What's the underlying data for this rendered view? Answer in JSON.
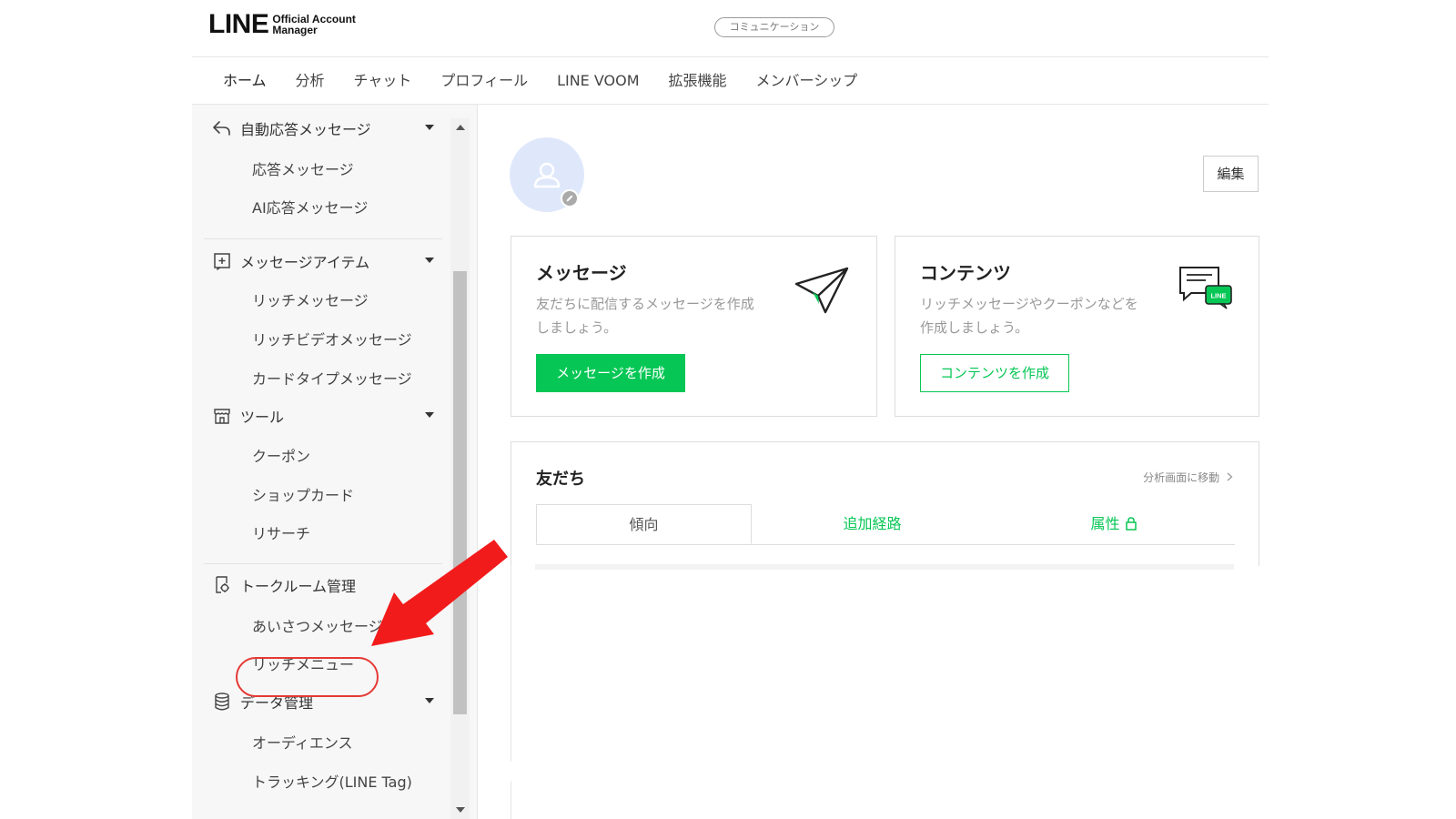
{
  "header": {
    "logo_main": "LINE",
    "logo_sub_line1": "Official Account",
    "logo_sub_line2": "Manager",
    "mode_badge": "コミュニケーション"
  },
  "nav": {
    "tabs": [
      "ホーム",
      "分析",
      "チャット",
      "プロフィール",
      "LINE VOOM",
      "拡張機能",
      "メンバーシップ"
    ],
    "active_tab": "ホーム"
  },
  "sidebar": {
    "groups": [
      {
        "label": "自動応答メッセージ",
        "icon": "reply-icon",
        "items": [
          "応答メッセージ",
          "AI応答メッセージ"
        ]
      },
      {
        "label": "メッセージアイテム",
        "icon": "plus-square-icon",
        "items": [
          "リッチメッセージ",
          "リッチビデオメッセージ",
          "カードタイプメッセージ"
        ]
      },
      {
        "label": "ツール",
        "icon": "shop-icon",
        "items": [
          "クーポン",
          "ショップカード",
          "リサーチ"
        ]
      },
      {
        "label": "トークルーム管理",
        "icon": "chat-settings-icon",
        "items": [
          "あいさつメッセージ",
          "リッチメニュー"
        ]
      },
      {
        "label": "データ管理",
        "icon": "database-icon",
        "items": [
          "オーディエンス",
          "トラッキング(LINE Tag)"
        ]
      }
    ],
    "highlighted_item": "リッチメニュー"
  },
  "profile": {
    "edit_label": "編集"
  },
  "cards": {
    "message": {
      "title": "メッセージ",
      "desc_line1": "友だちに配信するメッセージを作成",
      "desc_line2": "しましょう。",
      "button": "メッセージを作成",
      "icon": "paper-plane-icon"
    },
    "contents": {
      "title": "コンテンツ",
      "desc_line1": "リッチメッセージやクーポンなどを",
      "desc_line2": "作成しましょう。",
      "button": "コンテンツを作成",
      "icon": "line-chat-icon",
      "icon_badge": "LINE"
    }
  },
  "friends": {
    "title": "友だち",
    "link": "分析画面に移動",
    "tabs": [
      "傾向",
      "追加経路",
      "属性"
    ],
    "active_tab": "傾向"
  },
  "colors": {
    "brand_green": "#06c755",
    "annotation_red": "#e53935",
    "avatar_bg": "#dfe8fb"
  }
}
